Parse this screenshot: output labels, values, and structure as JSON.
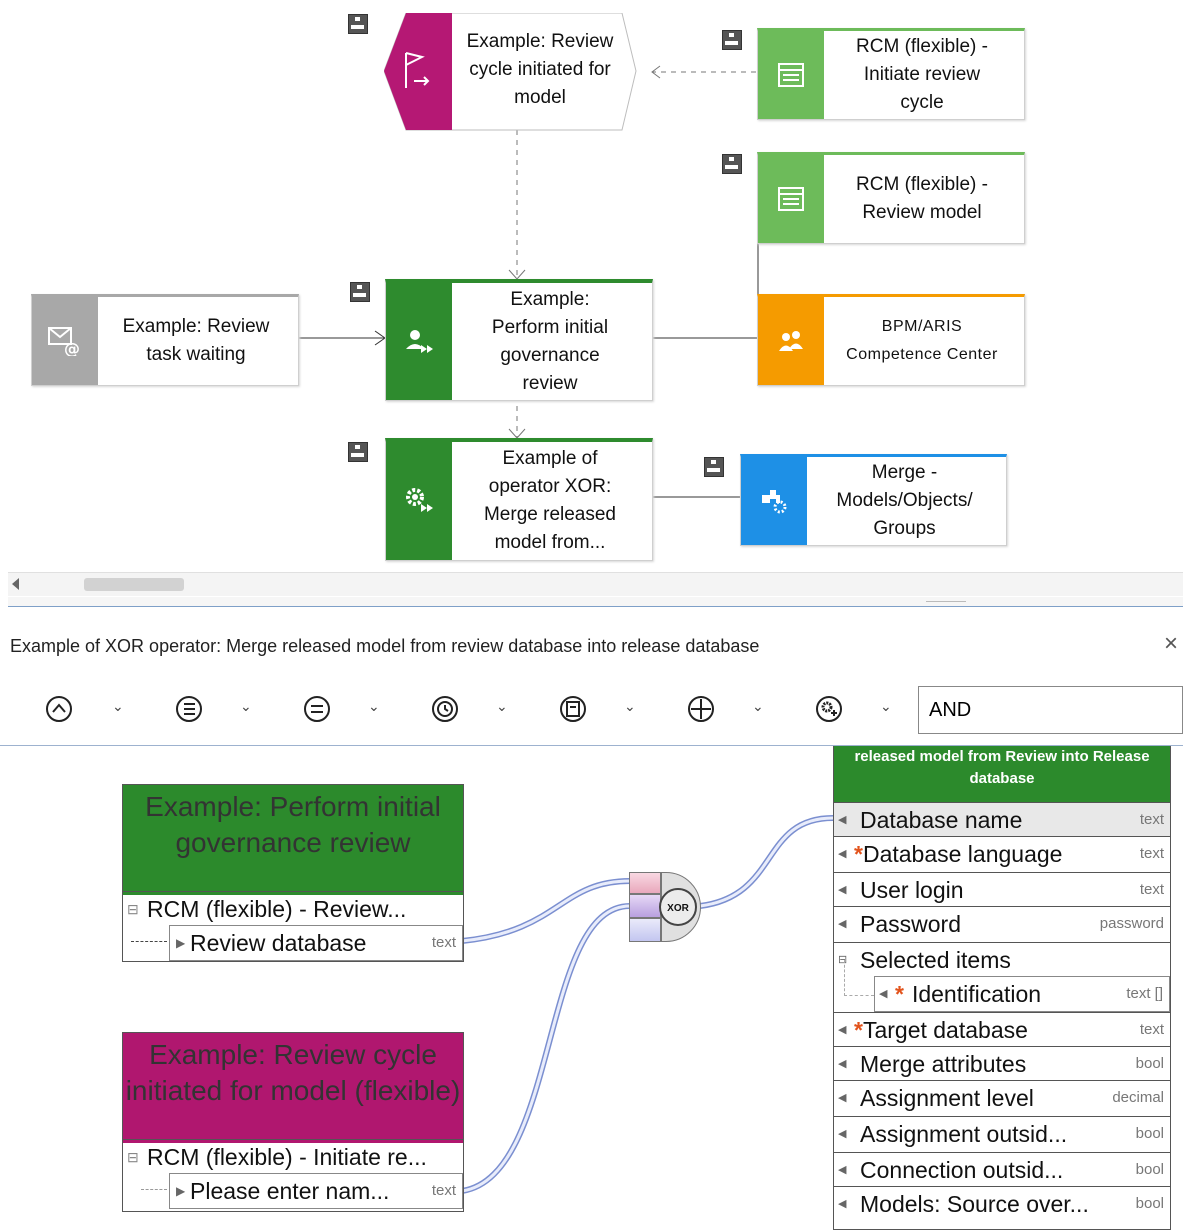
{
  "model_nodes": {
    "event_review_cycle": "Example: Review\ncycle initiated for\nmodel",
    "rcm_initiate": "RCM (flexible) -\nInitiate review\ncycle",
    "rcm_review_model": "RCM (flexible) -\nReview model",
    "msg_task_waiting": "Example: Review\ntask waiting",
    "func_perform_review": "Example:\nPerform initial\ngovernance\nreview",
    "org_bpm": "BPM/ARIS\nCompetence Center",
    "func_xor": "Example of\noperator XOR:\nMerge released\nmodel from...",
    "merge_service": "Merge -\nModels/Objects/\nGroups"
  },
  "panel": {
    "title": "Example of XOR operator: Merge released model from review database into release database",
    "close_label": "×",
    "operator_input": "AND"
  },
  "mapping": {
    "box1": {
      "title": "Example: Perform initial governance review",
      "row1": "RCM (flexible) - Review...",
      "row2": "Review database",
      "row2_type": "text"
    },
    "box2": {
      "title": "Example: Review cycle initiated for model (flexible)",
      "row1": "RCM (flexible) - Initiate re...",
      "row2": "Please enter nam...",
      "row2_type": "text"
    },
    "xor_label": "XOR",
    "target": {
      "header": "released model from Review into Release database",
      "rows": [
        {
          "label": "Database name",
          "type": "text",
          "required": false
        },
        {
          "label": "Database language",
          "type": "text",
          "required": true
        },
        {
          "label": "User login",
          "type": "text",
          "required": false
        },
        {
          "label": "Password",
          "type": "password",
          "required": false
        },
        {
          "label": "Selected items",
          "type": "",
          "required": false
        },
        {
          "label": "Identification",
          "type": "text []",
          "required": true
        },
        {
          "label": "Target database",
          "type": "text",
          "required": true
        },
        {
          "label": "Merge attributes",
          "type": "bool",
          "required": false
        },
        {
          "label": "Assignment level",
          "type": "decimal",
          "required": false
        },
        {
          "label": "Assignment outsid...",
          "type": "bool",
          "required": false
        },
        {
          "label": "Connection outsid...",
          "type": "bool",
          "required": false
        },
        {
          "label": "Models: Source over...",
          "type": "bool",
          "required": false
        }
      ]
    }
  },
  "colors": {
    "event": "#b51874",
    "function": "#2e8b2e",
    "screen": "#6dbb5a",
    "org": "#f59b00",
    "service": "#1e90e6",
    "message": "#a8a8a8",
    "header_green": "#2c8a2c",
    "header_magenta": "#b0176f"
  }
}
